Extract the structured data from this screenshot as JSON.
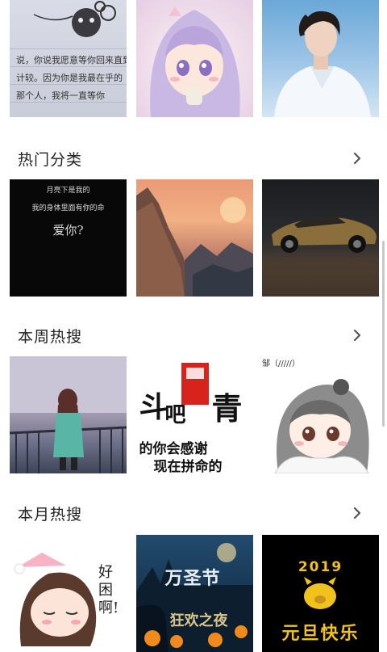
{
  "sections": {
    "hot_categories": {
      "title": "热门分类"
    },
    "weekly_hot": {
      "title": "本周热搜"
    },
    "monthly_hot": {
      "title": "本月热搜"
    }
  },
  "tiles": {
    "notebook_lines": [
      "说，你说我愿意等你回来直到",
      "计较。因为你是我最在乎的",
      "那个人，我将一直等你"
    ],
    "love_card_lines": [
      "月亮下是我的",
      "我的身体里面有你的命",
      "爱你?"
    ],
    "fight_text_1": "斗",
    "fight_text_2": "吧",
    "fight_text_3": "青",
    "fight_bottom_1": "的你会感谢",
    "fight_bottom_2": "现在拼命的",
    "chibi_caption": "邹（/////）",
    "cute_caption": "好困啊!",
    "halloween_title": "万圣节",
    "halloween_sub": "狂欢之夜",
    "newyear_year": "2019",
    "newyear_text": "元旦快乐"
  },
  "colors": {
    "accent_red": "#d8231d",
    "gold": "#f1c21b"
  },
  "icons": {
    "chevron": "chevron-right-icon"
  }
}
